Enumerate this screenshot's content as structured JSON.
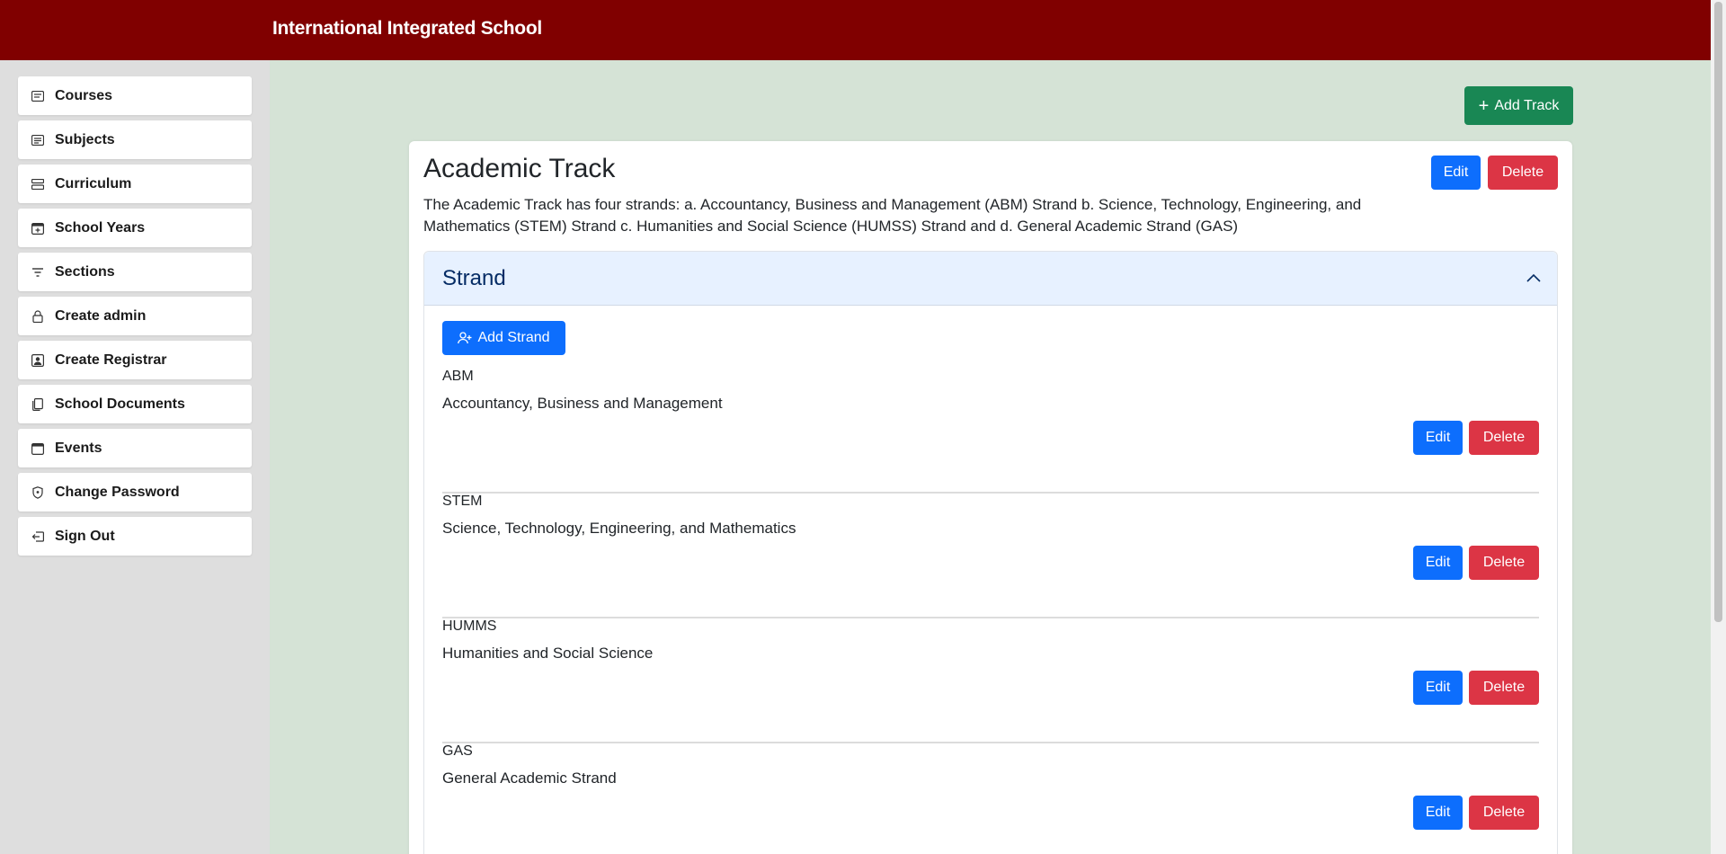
{
  "header": {
    "title": "International Integrated School"
  },
  "sidebar": {
    "items": [
      {
        "label": "Courses",
        "icon": "courses-icon"
      },
      {
        "label": "Subjects",
        "icon": "subjects-icon"
      },
      {
        "label": "Curriculum",
        "icon": "curriculum-icon"
      },
      {
        "label": "School Years",
        "icon": "calendar-plus-icon"
      },
      {
        "label": "Sections",
        "icon": "filter-icon"
      },
      {
        "label": "Create admin",
        "icon": "lock-icon"
      },
      {
        "label": "Create Registrar",
        "icon": "person-badge-icon"
      },
      {
        "label": "School Documents",
        "icon": "documents-icon"
      },
      {
        "label": "Events",
        "icon": "calendar-icon"
      },
      {
        "label": "Change Password",
        "icon": "shield-icon"
      },
      {
        "label": "Sign Out",
        "icon": "sign-out-icon"
      }
    ]
  },
  "toolbar": {
    "add_track_label": "Add Track"
  },
  "track": {
    "title": "Academic Track",
    "description": "The Academic Track has four strands: a. Accountancy, Business and Management (ABM) Strand b. Science, Technology, Engineering, and Mathematics (STEM) Strand c. Humanities and Social Science (HUMSS) Strand and d. General Academic Strand (GAS)",
    "edit_label": "Edit",
    "delete_label": "Delete"
  },
  "strand_section": {
    "title": "Strand",
    "add_label": "Add Strand",
    "edit_label": "Edit",
    "delete_label": "Delete",
    "items": [
      {
        "code": "ABM",
        "name": "Accountancy, Business and Management"
      },
      {
        "code": "STEM",
        "name": "Science, Technology, Engineering, and Mathematics"
      },
      {
        "code": "HUMMS",
        "name": "Humanities and Social Science"
      },
      {
        "code": "GAS",
        "name": "General Academic Strand"
      }
    ]
  },
  "colors": {
    "header": "#800000",
    "content_bg": "#d5e3d6",
    "primary": "#0d6efd",
    "danger": "#dc3545",
    "success": "#198754"
  }
}
